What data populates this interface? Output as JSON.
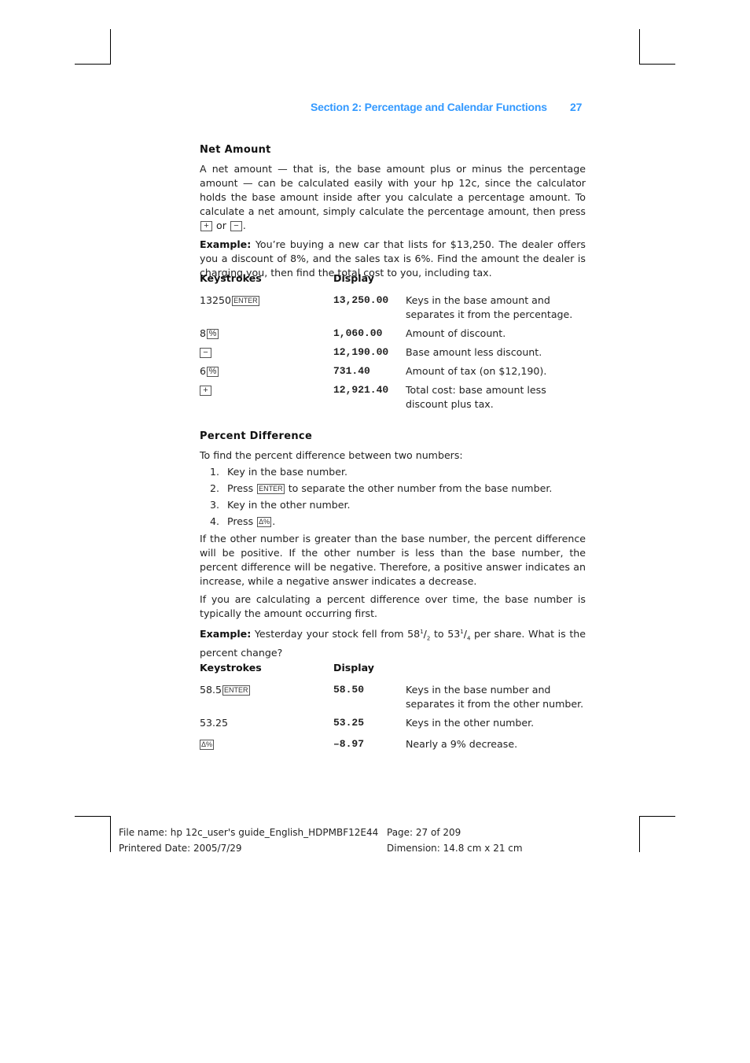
{
  "header": {
    "section_title": "Section 2: Percentage and Calendar Functions",
    "page_number": "27",
    "accent_color": "#3399ff"
  },
  "net_amount": {
    "heading": "Net Amount",
    "intro_text": "A net amount — that is, the base amount plus or minus the percentage amount — can be calculated easily with your hp 12c, since the calculator holds the base amount inside after you calculate a percentage amount. To calculate a net amount, simply calculate the percentage amount, then press",
    "intro_key_1": "+",
    "intro_or": "or",
    "intro_key_2": "−",
    "intro_end": ".",
    "example_label": "Example:",
    "example_text": "You’re buying a new car that lists for $13,250. The dealer offers you a discount of 8%, and the sales tax is 6%. Find the amount the dealer is charging you, then find the total cost to you, including tax.",
    "table": {
      "headers": [
        "Keystrokes",
        "Display",
        ""
      ],
      "rows": [
        {
          "keystroke_prefix": "13250",
          "key": "ENTER",
          "display": "13,250.00",
          "description": "Keys in the base amount and separates it from the percentage."
        },
        {
          "keystroke_prefix": "8",
          "key": "%",
          "display": "1,060.00",
          "description": "Amount of discount."
        },
        {
          "keystroke_prefix": "",
          "key": "−",
          "display": "12,190.00",
          "description": "Base amount less discount."
        },
        {
          "keystroke_prefix": "6",
          "key": "%",
          "display": "731.40",
          "description": "Amount of tax (on $12,190)."
        },
        {
          "keystroke_prefix": "",
          "key": "+",
          "display": "12,921.40",
          "description": "Total cost: base amount less discount plus tax."
        }
      ]
    }
  },
  "percent_difference": {
    "heading": "Percent Difference",
    "intro": "To find the percent difference between two numbers:",
    "steps": [
      {
        "num": "1.",
        "text": "Key in the base number.",
        "key": "",
        "after": ""
      },
      {
        "num": "2.",
        "text": "Press",
        "key": "ENTER",
        "after": "to separate the other number from the base number."
      },
      {
        "num": "3.",
        "text": "Key in the other number.",
        "key": "",
        "after": ""
      },
      {
        "num": "4.",
        "text": "Press",
        "key": "Δ%",
        "after": "."
      }
    ],
    "para1": "If the other number is greater than the base number, the percent difference will be positive. If the other number is less than the base number, the percent difference will be negative. Therefore, a positive answer indicates an increase, while a negative answer indicates a decrease.",
    "para2": "If you are calculating a percent difference over time, the base number is typically the amount occurring first.",
    "example_label": "Example:",
    "example_text_a": "Yesterday your stock fell from 58",
    "frac1_num": "1",
    "frac1_den": "2",
    "example_text_b": " to 53",
    "frac2_num": "1",
    "frac2_den": "4",
    "example_text_c": " per share. What is the percent change?",
    "table": {
      "headers": [
        "Keystrokes",
        "Display",
        ""
      ],
      "rows": [
        {
          "keystroke_prefix": "58.5",
          "key": "ENTER",
          "display": "58.50",
          "description": "Keys in the base number and separates it from the other number."
        },
        {
          "keystroke_prefix": "53.25",
          "key": "",
          "display": "53.25",
          "description": "Keys in the other number."
        },
        {
          "keystroke_prefix": "",
          "key": "Δ%",
          "display": "–8.97",
          "description": "Nearly a 9% decrease."
        }
      ]
    }
  },
  "footer": {
    "file_name": "File name: hp 12c_user's guide_English_HDPMBF12E44",
    "printed_date": "Printered Date: 2005/7/29",
    "page": "Page: 27 of 209",
    "dimension": "Dimension: 14.8 cm x 21 cm"
  }
}
